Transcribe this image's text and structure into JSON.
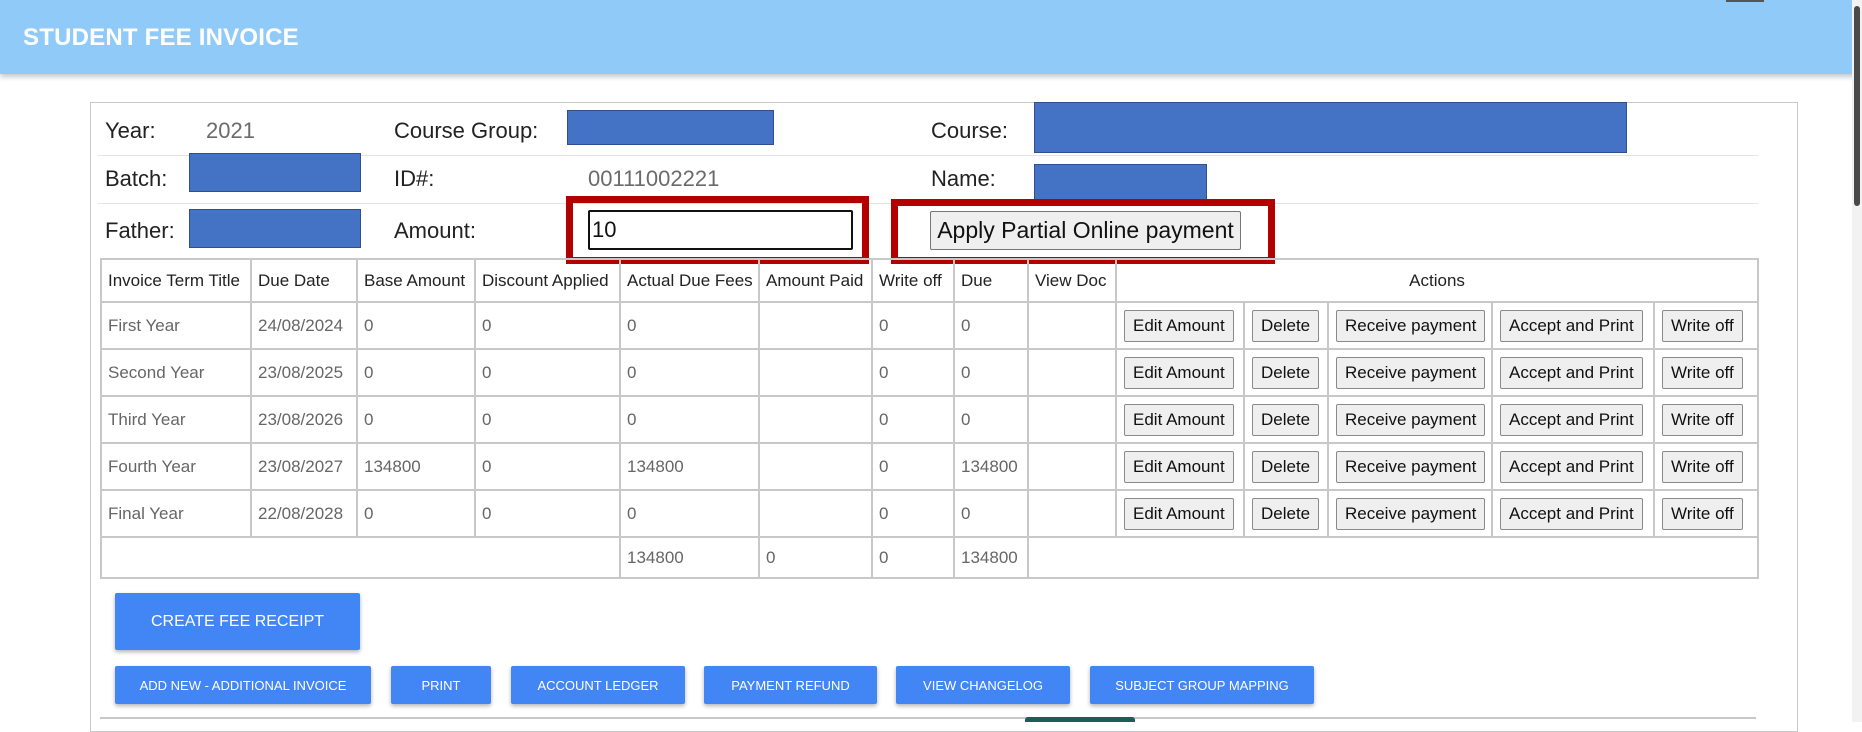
{
  "header": {
    "title": "STUDENT FEE INVOICE"
  },
  "student": {
    "year_label": "Year:",
    "year": "2021",
    "course_group_label": "Course Group:",
    "course_label": "Course:",
    "batch_label": "Batch:",
    "id_label": "ID#:",
    "id": "00111002221",
    "name_label": "Name:",
    "father_label": "Father:",
    "amount_label": "Amount:",
    "amount_value": "10",
    "apply_button": "Apply Partial Online payment"
  },
  "table": {
    "headers": [
      "Invoice Term Title",
      "Due Date",
      "Base Amount",
      "Discount Applied",
      "Actual Due Fees",
      "Amount Paid",
      "Write off",
      "Due",
      "View Doc",
      "Actions"
    ],
    "rows": [
      {
        "title": "First Year",
        "due_date": "24/08/2024",
        "base": "0",
        "discount": "0",
        "actual_due": "0",
        "paid": "",
        "write_off": "0",
        "due": "0"
      },
      {
        "title": "Second Year",
        "due_date": "23/08/2025",
        "base": "0",
        "discount": "0",
        "actual_due": "0",
        "paid": "",
        "write_off": "0",
        "due": "0"
      },
      {
        "title": "Third Year",
        "due_date": "23/08/2026",
        "base": "0",
        "discount": "0",
        "actual_due": "0",
        "paid": "",
        "write_off": "0",
        "due": "0"
      },
      {
        "title": "Fourth Year",
        "due_date": "23/08/2027",
        "base": "134800",
        "discount": "0",
        "actual_due": "134800",
        "paid": "",
        "write_off": "0",
        "due": "134800"
      },
      {
        "title": "Final Year",
        "due_date": "22/08/2028",
        "base": "0",
        "discount": "0",
        "actual_due": "0",
        "paid": "",
        "write_off": "0",
        "due": "0"
      }
    ],
    "actions": [
      "Edit Amount",
      "Delete",
      "Receive payment",
      "Accept and Print",
      "Write off"
    ],
    "totals": {
      "actual_due": "134800",
      "paid": "0",
      "write_off": "0",
      "due": "134800"
    }
  },
  "buttons": {
    "create_receipt": "CREATE FEE RECEIPT",
    "add_new": "ADD NEW - ADDITIONAL INVOICE",
    "print": "PRINT",
    "ledger": "ACCOUNT LEDGER",
    "refund": "PAYMENT REFUND",
    "changelog": "VIEW CHANGELOG",
    "subject_group": "SUBJECT GROUP MAPPING"
  },
  "colors": {
    "header_bg": "#90caf9",
    "button_blue": "#4285f4",
    "highlight_red": "#b30000",
    "redaction": "#4472c4"
  }
}
